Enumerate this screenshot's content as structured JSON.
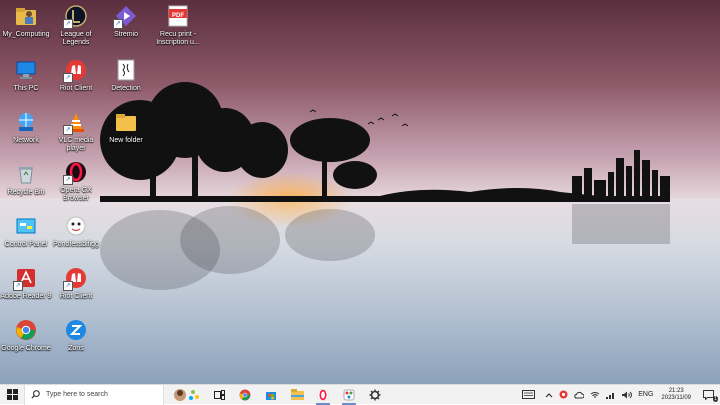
{
  "desktop": {
    "icons": [
      {
        "label": "My_Computing",
        "name": "my-computing-icon"
      },
      {
        "label": "League of Legends",
        "name": "league-of-legends-icon"
      },
      {
        "label": "Stremio",
        "name": "stremio-icon"
      },
      {
        "label": "Recu print - Inscription u...",
        "name": "pdf-file-icon"
      },
      {
        "label": "This PC",
        "name": "this-pc-icon"
      },
      {
        "label": "Riot Client",
        "name": "riot-client-icon"
      },
      {
        "label": "Detection",
        "name": "detection-icon"
      },
      {
        "label": "Network",
        "name": "network-icon"
      },
      {
        "label": "VLC media player",
        "name": "vlc-icon"
      },
      {
        "label": "New folder",
        "name": "new-folder-icon"
      },
      {
        "label": "Recycle Bin",
        "name": "recycle-bin-icon"
      },
      {
        "label": "Opera GX Browser",
        "name": "opera-gx-icon"
      },
      {
        "label": "Control Panel",
        "name": "control-panel-icon"
      },
      {
        "label": "Ponofessbifigg",
        "name": "ponofessbifigg-icon"
      },
      {
        "label": "Adobe Reader 9",
        "name": "adobe-reader-icon"
      },
      {
        "label": "Riot Client",
        "name": "riot-client-2-icon"
      },
      {
        "label": "Google Chrome",
        "name": "google-chrome-icon"
      },
      {
        "label": "Zoris",
        "name": "zoris-icon"
      }
    ],
    "pdf_badge": "PDF"
  },
  "taskbar": {
    "search_placeholder": "Type here to search",
    "language": "ENG",
    "time": "21:23",
    "date": "2023/11/09",
    "notification_count": "1"
  },
  "colors": {
    "taskbar_bg": "#f2f2f2",
    "accent": "#6a8cc7"
  }
}
